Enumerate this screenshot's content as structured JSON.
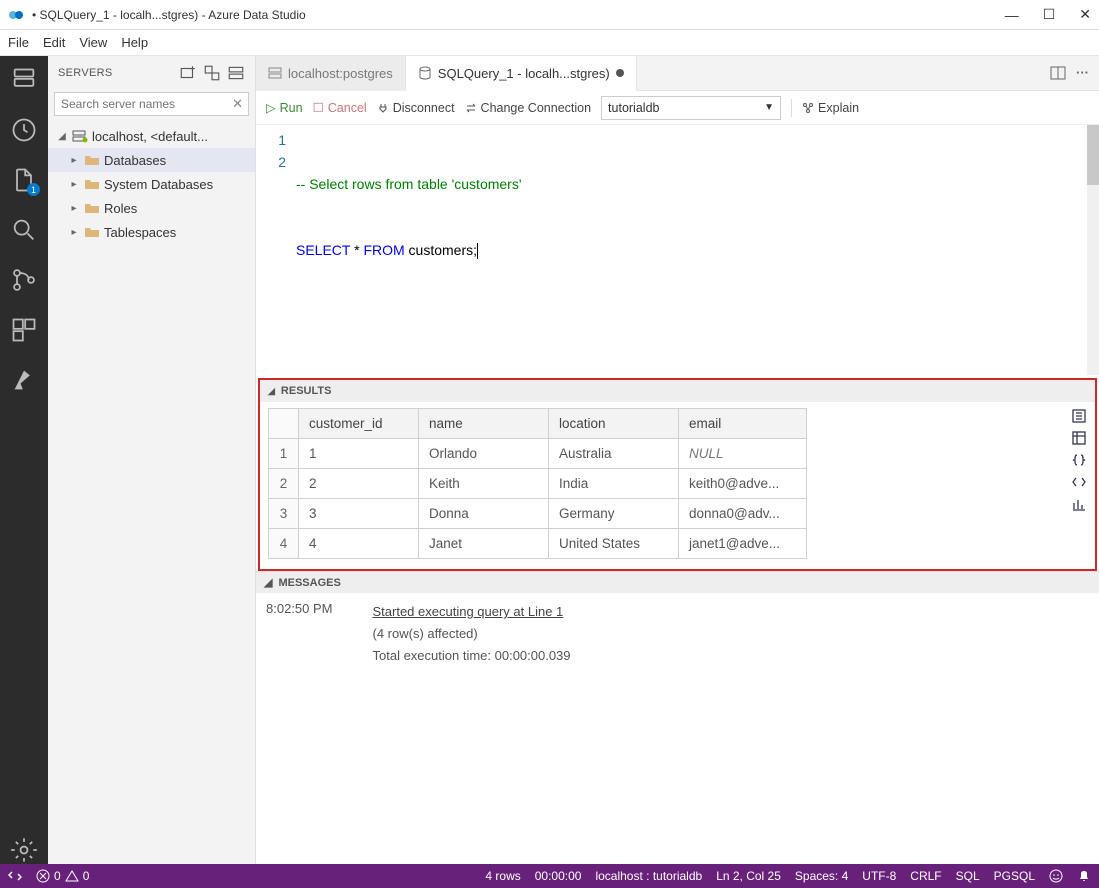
{
  "window": {
    "title": "• SQLQuery_1 - localh...stgres) - Azure Data Studio"
  },
  "menu": {
    "items": [
      "File",
      "Edit",
      "View",
      "Help"
    ]
  },
  "sidebar": {
    "title": "SERVERS",
    "search_placeholder": "Search server names",
    "root": "localhost, <default...",
    "nodes": [
      "Databases",
      "System Databases",
      "Roles",
      "Tablespaces"
    ]
  },
  "tabs": [
    {
      "label": "localhost:postgres",
      "active": false
    },
    {
      "label": "SQLQuery_1 - localh...stgres)",
      "active": true,
      "dirty": true
    }
  ],
  "toolbar": {
    "run": "Run",
    "cancel": "Cancel",
    "disconnect": "Disconnect",
    "change_conn": "Change Connection",
    "db": "tutorialdb",
    "explain": "Explain"
  },
  "code": {
    "line1_num": "1",
    "line2_num": "2",
    "comment": "-- Select rows from table 'customers'",
    "kw_select": "SELECT",
    "star": " * ",
    "kw_from": "FROM",
    "ident": " customers;"
  },
  "results": {
    "header": "RESULTS",
    "columns": [
      "customer_id",
      "name",
      "location",
      "email"
    ],
    "rows": [
      {
        "n": "1",
        "customer_id": "1",
        "name": "Orlando",
        "location": "Australia",
        "email": "NULL",
        "null": true
      },
      {
        "n": "2",
        "customer_id": "2",
        "name": "Keith",
        "location": "India",
        "email": "keith0@adve..."
      },
      {
        "n": "3",
        "customer_id": "3",
        "name": "Donna",
        "location": "Germany",
        "email": "donna0@adv..."
      },
      {
        "n": "4",
        "customer_id": "4",
        "name": "Janet",
        "location": "United States",
        "email": "janet1@adve..."
      }
    ]
  },
  "messages": {
    "header": "MESSAGES",
    "time": "8:02:50 PM",
    "line1": "Started executing query at Line 1",
    "line2": "(4 row(s) affected)",
    "line3": "Total execution time: 00:00:00.039"
  },
  "status": {
    "errors": "0",
    "warnings": "0",
    "rows": "4 rows",
    "elapsed": "00:00:00",
    "conn": "localhost : tutorialdb",
    "pos": "Ln 2, Col 25",
    "spaces": "Spaces: 4",
    "enc": "UTF-8",
    "eol": "CRLF",
    "lang": "SQL",
    "kernel": "PGSQL"
  }
}
